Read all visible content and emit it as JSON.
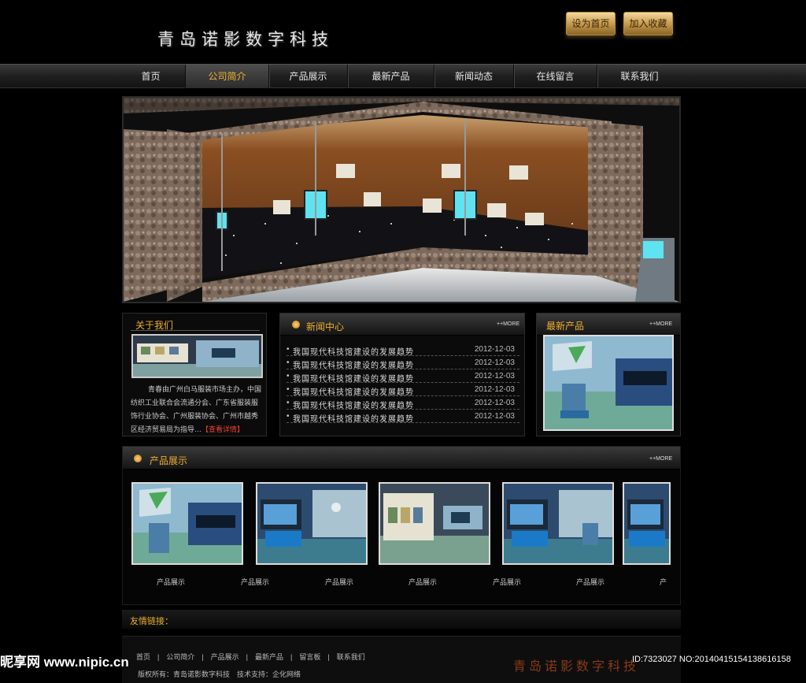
{
  "site": {
    "title": "青岛诺影数字科技"
  },
  "top_buttons": {
    "home": "设为首页",
    "favorite": "加入收藏"
  },
  "nav": {
    "items": [
      "首页",
      "公司简介",
      "产品展示",
      "最新产品",
      "新闻动态",
      "在线留言",
      "联系我们"
    ],
    "active": "公司简介"
  },
  "about": {
    "title": "关于我们",
    "text": "青春由广州白马服装市场主办，中国纺织工业联合会流通分会、广东省服装服饰行业协会、广州服装协会、广州市越秀区经济贸易局为指导…",
    "detail_link": "【查看详情】"
  },
  "news": {
    "title": "新闻中心",
    "more": "++MORE",
    "items": [
      {
        "title": "我国现代科技馆建设的发展趋势",
        "date": "2012-12-03"
      },
      {
        "title": "我国现代科技馆建设的发展趋势",
        "date": "2012-12-03"
      },
      {
        "title": "我国现代科技馆建设的发展趋势",
        "date": "2012-12-03"
      },
      {
        "title": "我国现代科技馆建设的发展趋势",
        "date": "2012-12-03"
      },
      {
        "title": "我国现代科技馆建设的发展趋势",
        "date": "2012-12-03"
      },
      {
        "title": "我国现代科技馆建设的发展趋势",
        "date": "2012-12-03"
      }
    ]
  },
  "latest": {
    "title": "最新产品",
    "more": "++MORE"
  },
  "products": {
    "title": "产品展示",
    "more": "++MORE",
    "labels": [
      "产品展示",
      "产品展示",
      "产品展示",
      "产品展示",
      "产品展示",
      "产品展示",
      "产"
    ]
  },
  "links": {
    "title": "友情链接："
  },
  "footer": {
    "nav": "首页　|　公司简介　|　产品展示　|　最新产品　|　留言板　|　联系我们",
    "copyright": "版权所有：青岛诺影数字科技　技术支持：企化网络",
    "watermark_logo": "青岛诺影数字科技"
  },
  "watermark": {
    "site": "昵享网 www.nipic.cn",
    "id": "ID:7323027 NO:20140415154138616158"
  }
}
